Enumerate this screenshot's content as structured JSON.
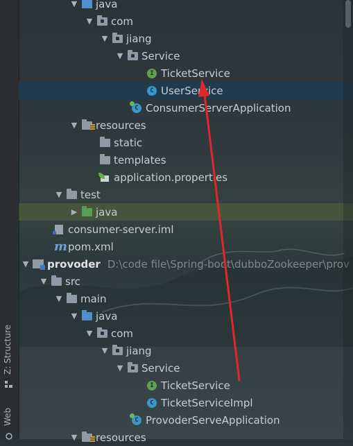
{
  "tool_strip": {
    "structure_tab": "Z: Structure",
    "web_tab": "Web"
  },
  "tree": {
    "rows": [
      {
        "label": "java"
      },
      {
        "label": "com"
      },
      {
        "label": "jiang"
      },
      {
        "label": "Service"
      },
      {
        "label": "TicketService"
      },
      {
        "label": "UserService"
      },
      {
        "label": "ConsumerServerApplication"
      },
      {
        "label": "resources"
      },
      {
        "label": "static"
      },
      {
        "label": "templates"
      },
      {
        "label": "application.properties"
      },
      {
        "label": "test"
      },
      {
        "label": "java"
      },
      {
        "label": "consumer-server.iml"
      },
      {
        "label": "pom.xml"
      },
      {
        "label": "provoder",
        "path": "D:\\code file\\Spring-boot\\dubboZookeeper\\prov"
      },
      {
        "label": "src"
      },
      {
        "label": "main"
      },
      {
        "label": "java"
      },
      {
        "label": "com"
      },
      {
        "label": "jiang"
      },
      {
        "label": "Service"
      },
      {
        "label": "TicketService"
      },
      {
        "label": "TicketServiceImpl"
      },
      {
        "label": "ProvoderServeApplication"
      },
      {
        "label": "resources"
      }
    ]
  },
  "colors": {
    "annotation_arrow": "#e0282c",
    "selection": "#203a4e"
  },
  "icons": {
    "interface": "I",
    "class": "C"
  }
}
